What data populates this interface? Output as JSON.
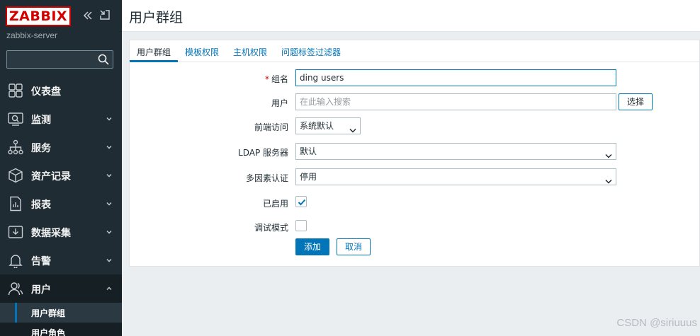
{
  "sidebar": {
    "logo": "ZABBIX",
    "server_name": "zabbix-server",
    "search_value": "",
    "menu": [
      {
        "label": "仪表盘",
        "icon": "dashboard-icon",
        "expandable": false
      },
      {
        "label": "监测",
        "icon": "monitoring-icon",
        "expandable": true
      },
      {
        "label": "服务",
        "icon": "services-icon",
        "expandable": true
      },
      {
        "label": "资产记录",
        "icon": "inventory-icon",
        "expandable": true
      },
      {
        "label": "报表",
        "icon": "reports-icon",
        "expandable": true
      },
      {
        "label": "数据采集",
        "icon": "data-collection-icon",
        "expandable": true
      },
      {
        "label": "告警",
        "icon": "alerts-icon",
        "expandable": true
      },
      {
        "label": "用户",
        "icon": "users-icon",
        "expandable": true,
        "expanded": true
      }
    ],
    "submenu": [
      {
        "label": "用户群组",
        "selected": true
      },
      {
        "label": "用户角色",
        "selected": false
      }
    ]
  },
  "header": {
    "title": "用户群组"
  },
  "tabs": [
    {
      "label": "用户群组",
      "active": true
    },
    {
      "label": "模板权限",
      "active": false
    },
    {
      "label": "主机权限",
      "active": false
    },
    {
      "label": "问题标签过滤器",
      "active": false
    }
  ],
  "form": {
    "group_name": {
      "label": "组名",
      "value": "ding users",
      "required": true
    },
    "users": {
      "label": "用户",
      "placeholder": "在此输入搜索",
      "select_label": "选择"
    },
    "frontend_access": {
      "label": "前端访问",
      "value": "系统默认"
    },
    "ldap_server": {
      "label": "LDAP 服务器",
      "value": "默认"
    },
    "mfa": {
      "label": "多因素认证",
      "value": "停用"
    },
    "enabled": {
      "label": "已启用",
      "checked": true
    },
    "debug_mode": {
      "label": "调试模式",
      "checked": false
    },
    "add_label": "添加",
    "cancel_label": "取消"
  },
  "watermark": "CSDN @siriuuus",
  "colors": {
    "sidebar_bg": "#1f2c33",
    "accent": "#0275b8",
    "logo_red": "#d40000"
  }
}
